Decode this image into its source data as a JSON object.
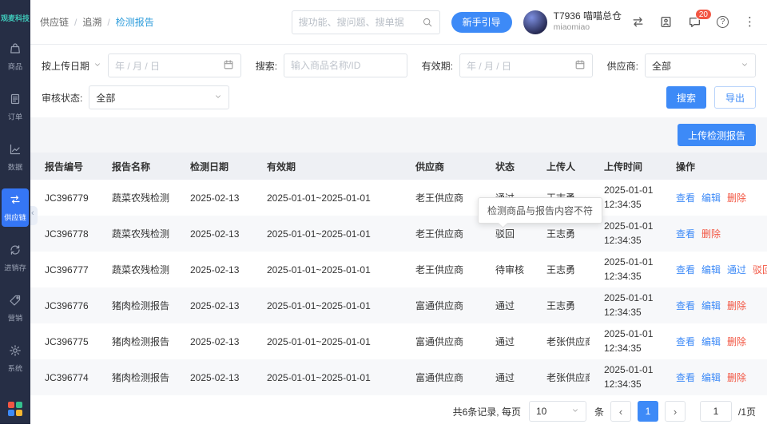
{
  "sidebar": {
    "logo": "观麦科技",
    "items": [
      {
        "label": "商品",
        "icon": "goods",
        "active": false
      },
      {
        "label": "订单",
        "icon": "orders",
        "active": false
      },
      {
        "label": "数据",
        "icon": "data",
        "active": false
      },
      {
        "label": "供应链",
        "icon": "supply",
        "active": true
      },
      {
        "label": "进销存",
        "icon": "inventory",
        "active": false
      },
      {
        "label": "营销",
        "icon": "marketing",
        "active": false
      },
      {
        "label": "系统",
        "icon": "system",
        "active": false
      }
    ]
  },
  "header": {
    "breadcrumb": [
      "供应链",
      "追溯",
      "检测报告"
    ],
    "search_placeholder": "搜功能、搜问题、搜单据",
    "guide_button": "新手引导",
    "user": {
      "name": "T7936 喵喵总仓",
      "subname": "miaomiao"
    },
    "badge_count": "20",
    "help_glyph": "?",
    "more_glyph": "⋮"
  },
  "filters": {
    "date_type_label": "按上传日期",
    "upload_date_placeholder": "年 / 月 / 日",
    "search_label": "搜索:",
    "search_placeholder": "输入商品名称/ID",
    "validity_label": "有效期:",
    "validity_placeholder": "年 / 月 / 日",
    "supplier_label": "供应商:",
    "supplier_value": "全部",
    "audit_label": "审核状态:",
    "audit_value": "全部",
    "search_button": "搜索",
    "export_button": "导出"
  },
  "toolbar": {
    "upload_button": "上传检测报告"
  },
  "tooltip": {
    "text": "检测商品与报告内容不符"
  },
  "table": {
    "columns": [
      "报告编号",
      "报告名称",
      "检测日期",
      "有效期",
      "供应商",
      "状态",
      "上传人",
      "上传时间",
      "操作"
    ],
    "rows": [
      {
        "id": "JC396779",
        "name": "蔬菜农残检测",
        "date": "2025-02-13",
        "validity": "2025-01-01~2025-01-01",
        "supplier": "老王供应商",
        "status": "通过",
        "uploader": "王志勇",
        "time_date": "2025-01-01",
        "time_clock": "12:34:35",
        "actions": [
          {
            "label": "查看",
            "type": "primary"
          },
          {
            "label": "编辑",
            "type": "primary"
          },
          {
            "label": "删除",
            "type": "danger"
          }
        ]
      },
      {
        "id": "JC396778",
        "name": "蔬菜农残检测",
        "date": "2025-02-13",
        "validity": "2025-01-01~2025-01-01",
        "supplier": "老王供应商",
        "status": "驳回",
        "uploader": "王志勇",
        "time_date": "2025-01-01",
        "time_clock": "12:34:35",
        "actions": [
          {
            "label": "查看",
            "type": "primary"
          },
          {
            "label": "删除",
            "type": "danger"
          }
        ]
      },
      {
        "id": "JC396777",
        "name": "蔬菜农残检测",
        "date": "2025-02-13",
        "validity": "2025-01-01~2025-01-01",
        "supplier": "老王供应商",
        "status": "待审核",
        "uploader": "王志勇",
        "time_date": "2025-01-01",
        "time_clock": "12:34:35",
        "actions": [
          {
            "label": "查看",
            "type": "primary"
          },
          {
            "label": "编辑",
            "type": "primary"
          },
          {
            "label": "通过",
            "type": "primary"
          },
          {
            "label": "驳回",
            "type": "danger"
          }
        ]
      },
      {
        "id": "JC396776",
        "name": "猪肉检测报告",
        "date": "2025-02-13",
        "validity": "2025-01-01~2025-01-01",
        "supplier": "富通供应商",
        "status": "通过",
        "uploader": "王志勇",
        "time_date": "2025-01-01",
        "time_clock": "12:34:35",
        "actions": [
          {
            "label": "查看",
            "type": "primary"
          },
          {
            "label": "编辑",
            "type": "primary"
          },
          {
            "label": "删除",
            "type": "danger"
          }
        ]
      },
      {
        "id": "JC396775",
        "name": "猪肉检测报告",
        "date": "2025-02-13",
        "validity": "2025-01-01~2025-01-01",
        "supplier": "富通供应商",
        "status": "通过",
        "uploader": "老张供应商",
        "time_date": "2025-01-01",
        "time_clock": "12:34:35",
        "actions": [
          {
            "label": "查看",
            "type": "primary"
          },
          {
            "label": "编辑",
            "type": "primary"
          },
          {
            "label": "删除",
            "type": "danger"
          }
        ]
      },
      {
        "id": "JC396774",
        "name": "猪肉检测报告",
        "date": "2025-02-13",
        "validity": "2025-01-01~2025-01-01",
        "supplier": "富通供应商",
        "status": "通过",
        "uploader": "老张供应商",
        "time_date": "2025-01-01",
        "time_clock": "12:34:35",
        "actions": [
          {
            "label": "查看",
            "type": "primary"
          },
          {
            "label": "编辑",
            "type": "primary"
          },
          {
            "label": "删除",
            "type": "danger"
          }
        ]
      }
    ]
  },
  "pagination": {
    "total_text": "共6条记录, 每页",
    "page_size": "10",
    "unit": "条",
    "prev_glyph": "‹",
    "next_glyph": "›",
    "current_page": "1",
    "jump_value": "1",
    "total_pages": "/1页"
  },
  "colors": {
    "accent": "#3d8af7",
    "danger": "#f25643",
    "sidebar_bg": "#262e45",
    "breadcrumb_active": "#2d9cdb"
  }
}
